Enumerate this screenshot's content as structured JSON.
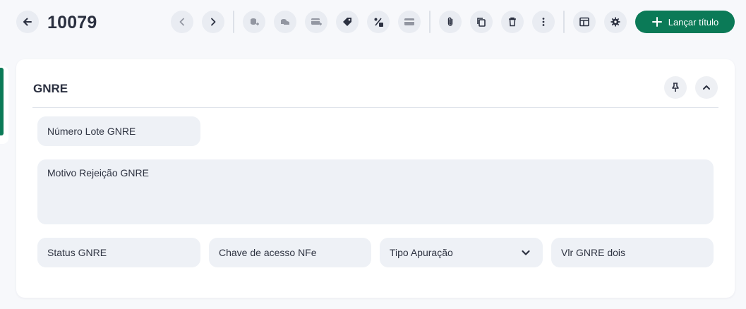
{
  "header": {
    "record_id": "10079",
    "primary_action_label": "Lançar título"
  },
  "toolbar_icons": [
    "back-arrow-icon",
    "chevron-left-icon",
    "chevron-right-icon",
    "coins-stack-icon",
    "coins-icon",
    "card-plus-icon",
    "tag-icon",
    "percent-icon",
    "credit-card-icon",
    "paperclip-icon",
    "copy-icon",
    "trash-icon",
    "more-vertical-icon",
    "layout-icon",
    "gear-icon",
    "plus-icon"
  ],
  "section": {
    "title": "GNRE",
    "fields": {
      "numero_lote": {
        "placeholder": "Número Lote GNRE"
      },
      "motivo_rejeicao": {
        "placeholder": "Motivo Rejeição GNRE"
      },
      "status": {
        "placeholder": "Status GNRE"
      },
      "chave_acesso": {
        "placeholder": "Chave de acesso NFe"
      },
      "tipo_apuracao": {
        "placeholder": "Tipo Apuração"
      },
      "vlr_gnre_dois": {
        "placeholder": "Vlr GNRE dois"
      }
    }
  },
  "colors": {
    "accent": "#0b7a57",
    "background": "#f7f8fb",
    "field_bg": "#eef1f6",
    "icon_bg": "#e9ecf2"
  }
}
